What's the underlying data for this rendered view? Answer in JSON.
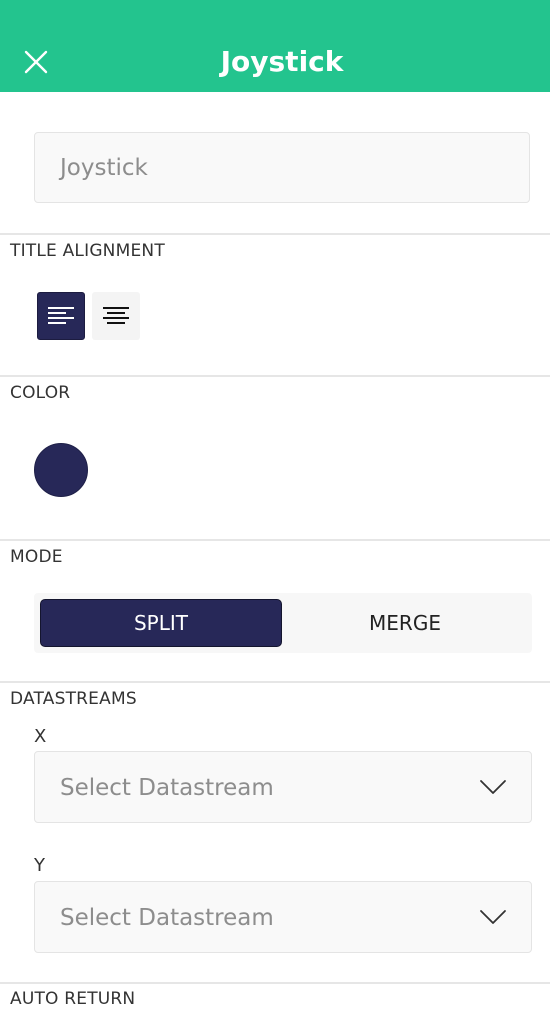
{
  "header": {
    "title": "Joystick",
    "close_icon": "close-icon"
  },
  "name_input": {
    "value": "Joystick"
  },
  "title_alignment": {
    "label": "TITLE ALIGNMENT",
    "options": [
      {
        "icon": "align-left-icon",
        "selected": true
      },
      {
        "icon": "align-center-icon",
        "selected": false
      }
    ]
  },
  "color": {
    "label": "COLOR",
    "value": "#272858"
  },
  "mode": {
    "label": "MODE",
    "options": [
      "SPLIT",
      "MERGE"
    ],
    "selected": "SPLIT"
  },
  "datastreams": {
    "label": "DATASTREAMS",
    "x": {
      "label": "X",
      "placeholder": "Select Datastream",
      "icon": "chevron-down-icon"
    },
    "y": {
      "label": "Y",
      "placeholder": "Select Datastream",
      "icon": "chevron-down-icon"
    }
  },
  "auto_return": {
    "label": "AUTO RETURN"
  },
  "colors": {
    "header_bg": "#23c48e",
    "accent": "#272858"
  }
}
